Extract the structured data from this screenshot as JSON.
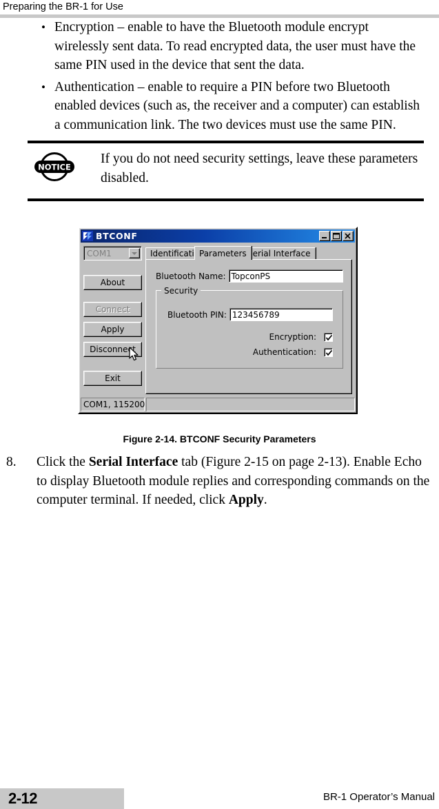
{
  "header": {
    "title": "Preparing the BR-1 for Use"
  },
  "bullets": [
    "Encryption – enable to have the Bluetooth module encrypt wirelessly sent data. To read encrypted data, the user must have the same PIN used in the device that sent the data.",
    "Authentication – enable to require a PIN before two Bluetooth enabled devices (such as, the receiver and a computer) can establish a communication link. The two devices must use the same PIN."
  ],
  "notice": {
    "icon_label": "NOTICE",
    "text": "If you do not need security settings, leave these parameters disabled."
  },
  "dialog": {
    "title": "BTCONF",
    "window_buttons": {
      "minimize": "minimize-button",
      "maximize": "maximize-button",
      "close": "close-button"
    },
    "port_combo": {
      "value": "COM1"
    },
    "buttons": [
      {
        "label": "About",
        "disabled": false
      },
      {
        "label": "Connect",
        "disabled": true
      },
      {
        "label": "Apply",
        "disabled": false
      },
      {
        "label": "Disconnect",
        "disabled": false
      },
      {
        "label": "Exit",
        "disabled": false
      }
    ],
    "tabs": [
      {
        "label": "Identification",
        "active": false
      },
      {
        "label": "Parameters",
        "active": true
      },
      {
        "label": "Serial Interface",
        "active": false
      }
    ],
    "parameters_tab": {
      "bluetooth_name_label": "Bluetooth Name:",
      "bluetooth_name_value": "TopconPS",
      "security_group_title": "Security",
      "bluetooth_pin_label": "Bluetooth PIN:",
      "bluetooth_pin_value": "123456789",
      "encryption_label": "Encryption:",
      "encryption_checked": true,
      "authentication_label": "Authentication:",
      "authentication_checked": true
    },
    "statusbar": {
      "pane1": "COM1, 115200",
      "pane2": ""
    }
  },
  "figure": {
    "caption": "Figure 2-14. BTCONF Security Parameters"
  },
  "step": {
    "number": "8.",
    "part1": "Click the ",
    "bold1": "Serial Interface",
    "part2": " tab (Figure 2-15 on page 2-13). Enable Echo to display Bluetooth module replies and corresponding commands on the computer terminal. If needed, click ",
    "bold2": "Apply",
    "part3": "."
  },
  "footer": {
    "page_number": "2-12",
    "manual_title": "BR-1 Operator’s Manual"
  }
}
